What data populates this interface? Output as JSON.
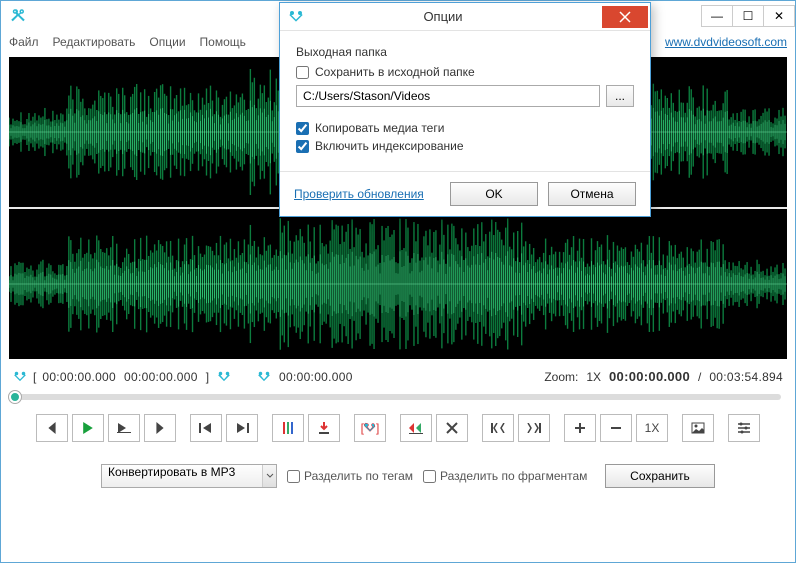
{
  "colors": {
    "accent": "#2ab8d3",
    "danger": "#d9472f",
    "play": "#18a03c",
    "wave": "#0c7c3e"
  },
  "menubar": {
    "file": "Файл",
    "edit": "Редактировать",
    "options": "Опции",
    "help": "Помощь",
    "site_link": "www.dvdvideosoft.com"
  },
  "selection": {
    "start": "00:00:00.000",
    "end": "00:00:00.000",
    "cursor": "00:00:00.000"
  },
  "zoom": {
    "label": "Zoom:",
    "value": "1X"
  },
  "position": {
    "current": "00:00:00.000",
    "total": "00:03:54.894",
    "sep": "/"
  },
  "toolbar_zoom_level": "1X",
  "bottombar": {
    "convert_label": "Конвертировать в MP3",
    "split_tags": "Разделить по тегам",
    "split_fragments": "Разделить по фрагментам",
    "save": "Сохранить"
  },
  "modal": {
    "title": "Опции",
    "output_folder_label": "Выходная папка",
    "save_in_source_label": "Сохранить в исходной папке",
    "path": "C:/Users/Stason/Videos",
    "browse": "...",
    "copy_media_tags": "Копировать медиа теги",
    "enable_indexing": "Включить индексирование",
    "check_updates": "Проверить обновления",
    "ok": "OK",
    "cancel": "Отмена"
  },
  "window_buttons": {
    "min": "—",
    "max": "☐",
    "close": "✕"
  }
}
